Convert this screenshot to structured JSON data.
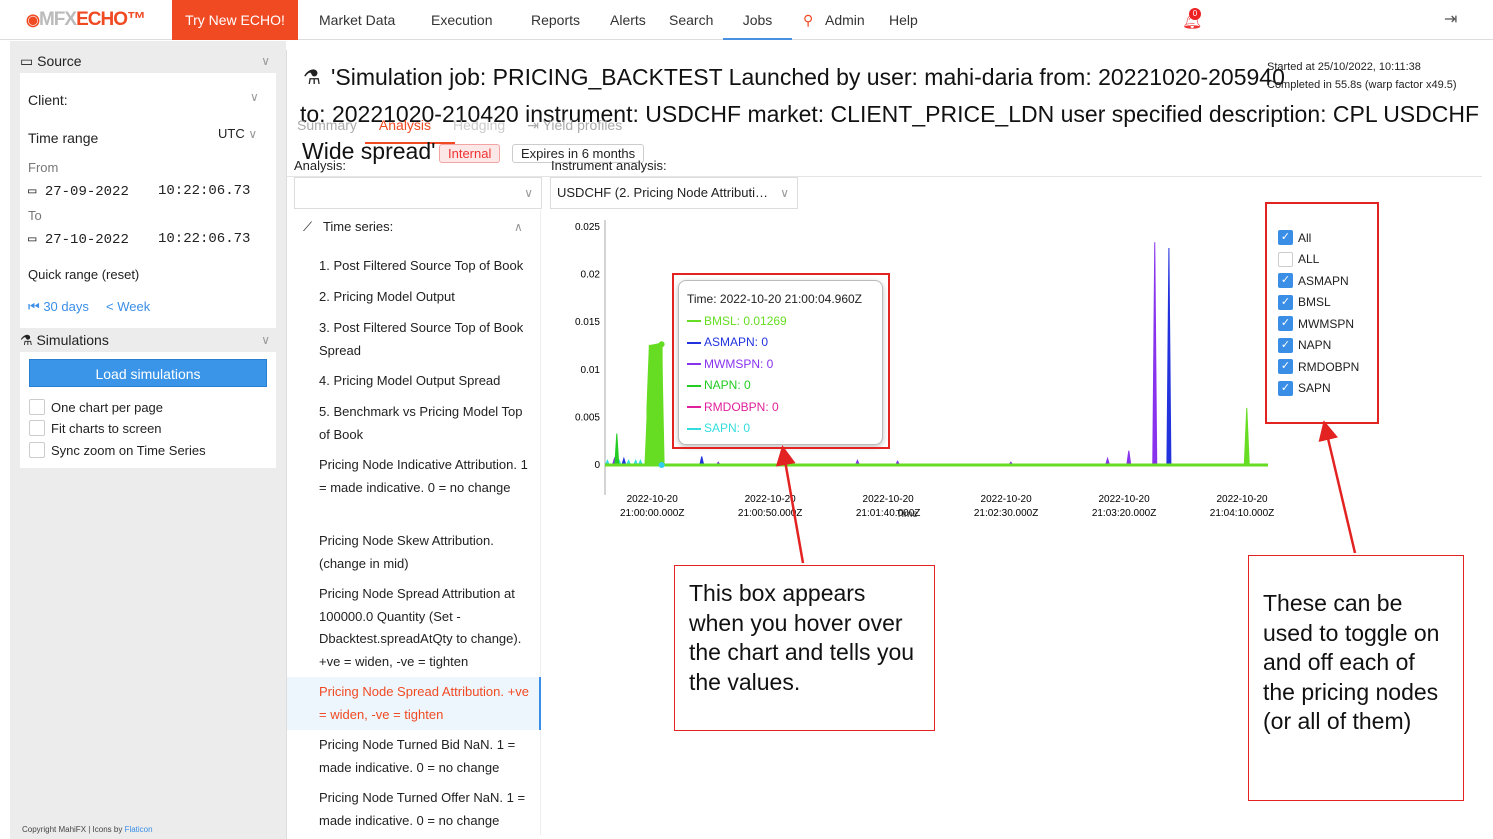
{
  "topbar": {
    "logo": "MFX ECHO",
    "logo_a": "MFX",
    "logo_b": "ECHO™",
    "try_new": "Try New ECHO!",
    "nav": [
      "Market Data",
      "Execution",
      "Reports",
      "Alerts",
      "Search",
      "Jobs",
      "Admin",
      "Help"
    ],
    "active_nav": "Jobs",
    "notification_count": "0"
  },
  "sidebar": {
    "source": {
      "title": "Source",
      "client_label": "Client:",
      "time_range_label": "Time range",
      "timezone": "UTC",
      "from_label": "From",
      "from_date": "27-09-2022",
      "from_time": "10:22:06.73",
      "to_label": "To",
      "to_date": "27-10-2022",
      "to_time": "10:22:06.73",
      "quick_range": "Quick range (reset)",
      "quick_30": "30 days",
      "quick_week": "Week"
    },
    "simulations": {
      "title": "Simulations",
      "load_button": "Load simulations",
      "options": [
        {
          "label": "One chart per page",
          "checked": false
        },
        {
          "label": "Fit charts to screen",
          "checked": false
        },
        {
          "label": "Sync zoom on Time Series",
          "checked": false
        }
      ]
    },
    "footer_a": "Copyright MahiFX | Icons by ",
    "footer_b": "Flaticon"
  },
  "main": {
    "title_line1": "'Simulation job: PRICING_BACKTEST Launched by user: mahi-daria from: 20221020-205940",
    "title_line2": "to: 20221020-210420 instrument: USDCHF market: CLIENT_PRICE_LDN user specified description: CPL USDCHF",
    "title_line3": "Wide spread'",
    "tag_internal": "Internal",
    "tag_expires": "Expires in 6 months",
    "started": "Started at 25/10/2022, 10:11:38",
    "completed": "Completed in 55.8s (warp factor x49.5)",
    "tabs": [
      "Summary",
      "Analysis",
      "Hedging",
      "Yield profiles"
    ],
    "active_tab": "Analysis",
    "analysis_label": "Analysis:",
    "analysis_value": "",
    "instrument_label": "Instrument analysis:",
    "instrument_value": "USDCHF (2. Pricing Node Attributi…",
    "time_series_label": "Time series:",
    "time_series": [
      "1. Post Filtered Source Top of Book",
      "2. Pricing Model Output",
      "3. Post Filtered Source Top of Book Spread",
      "4. Pricing Model Output Spread",
      "5. Benchmark vs Pricing Model Top of Book",
      "Pricing Node Indicative Attribution. 1 = made indicative. 0 = no change",
      "Pricing Node Skew Attribution. (change in mid)",
      "Pricing Node Spread Attribution at 100000.0 Quantity (Set -Dbacktest.spreadAtQty to change). +ve = widen, -ve = tighten",
      "Pricing Node Spread Attribution. +ve = widen, -ve = tighten",
      "Pricing Node Turned Bid NaN. 1 = made indicative. 0 = no change",
      "Pricing Node Turned Offer NaN. 1 = made indicative. 0 = no change"
    ],
    "selected_series_index": 8
  },
  "tooltip": {
    "time": "Time: 2022-10-20 21:00:04.960Z",
    "rows": [
      {
        "text": "BMSL: 0.01269",
        "color": "#66dd22"
      },
      {
        "text": "ASMAPN: 0",
        "color": "#2233dd"
      },
      {
        "text": "MWMSPN: 0",
        "color": "#8833ee"
      },
      {
        "text": "NAPN: 0",
        "color": "#22cc22"
      },
      {
        "text": "RMDOBPN: 0",
        "color": "#e0209a"
      },
      {
        "text": "SAPN: 0",
        "color": "#33dddd"
      }
    ]
  },
  "legend": [
    {
      "label": "All",
      "checked": true
    },
    {
      "label": "ALL",
      "checked": false
    },
    {
      "label": "ASMAPN",
      "checked": true
    },
    {
      "label": "BMSL",
      "checked": true
    },
    {
      "label": "MWMSPN",
      "checked": true
    },
    {
      "label": "NAPN",
      "checked": true
    },
    {
      "label": "RMDOBPN",
      "checked": true
    },
    {
      "label": "SAPN",
      "checked": true
    }
  ],
  "notes": {
    "hover": "This box appears when you hover over the chart and tells you the values.",
    "toggle": "These can be used to toggle on and off each of the pricing nodes (or all of them)"
  },
  "chart_data": {
    "type": "line",
    "xlabel": "Time",
    "ylim": [
      0,
      0.025
    ],
    "yticks": [
      "0",
      "0.005",
      "0.01",
      "0.015",
      "0.02",
      "0.025"
    ],
    "xticks": [
      [
        "2022-10-20",
        "21:00:00.000Z"
      ],
      [
        "2022-10-20",
        "21:00:50.000Z"
      ],
      [
        "2022-10-20",
        "21:01:40.000Z"
      ],
      [
        "2022-10-20",
        "21:02:30.000Z"
      ],
      [
        "2022-10-20",
        "21:03:20.000Z"
      ],
      [
        "2022-10-20",
        "21:04:10.000Z"
      ]
    ],
    "xrange": [
      "2022-10-20T20:59:40Z",
      "2022-10-20T21:04:21Z"
    ],
    "series": [
      {
        "name": "SAPN",
        "color": "#33dddd",
        "points": [
          [
            "2022-10-20T20:59:41Z",
            0.0005
          ],
          [
            "2022-10-20T20:59:46Z",
            0.0005
          ],
          [
            "2022-10-20T20:59:50Z",
            0.0005
          ],
          [
            "2022-10-20T20:59:53Z",
            0.0005
          ],
          [
            "2022-10-20T20:59:55Z",
            0.0005
          ]
        ]
      },
      {
        "name": "MWMSPN",
        "color": "#8833ee",
        "points": [
          [
            "2022-10-20T20:59:44Z",
            0.0007
          ],
          [
            "2022-10-20T21:00:28Z",
            0.0003
          ],
          [
            "2022-10-20T21:01:27Z",
            0.0005
          ],
          [
            "2022-10-20T21:01:44Z",
            0.0004
          ],
          [
            "2022-10-20T21:02:32Z",
            0.0003
          ],
          [
            "2022-10-20T21:03:13Z",
            0.0007
          ],
          [
            "2022-10-20T21:03:22Z",
            0.0015
          ],
          [
            "2022-10-20T21:03:33Z",
            0.0234
          ]
        ]
      },
      {
        "name": "ASMAPN",
        "color": "#2233dd",
        "points": [
          [
            "2022-10-20T20:59:48Z",
            0.0007
          ],
          [
            "2022-10-20T21:00:21Z",
            0.0009
          ],
          [
            "2022-10-20T21:03:39Z",
            0.0228
          ]
        ]
      },
      {
        "name": "NAPN",
        "color": "#22cc22",
        "points": [
          [
            "2022-10-20T20:59:45Z",
            0.0033
          ],
          [
            "2022-10-20T20:59:59Z",
            0.0018
          ]
        ]
      },
      {
        "name": "BMSL",
        "color": "#66dd22",
        "points": [
          [
            "2022-10-20T20:59:58Z",
            0.006
          ],
          [
            "2022-10-20T20:59:59Z",
            0.0125
          ],
          [
            "2022-10-20T21:00:01Z",
            0.0126
          ],
          [
            "2022-10-20T21:00:03Z",
            0.0127
          ],
          [
            "2022-10-20T21:00:04Z",
            0.01269
          ],
          [
            "2022-10-20T21:04:12Z",
            0.006
          ]
        ]
      }
    ]
  }
}
